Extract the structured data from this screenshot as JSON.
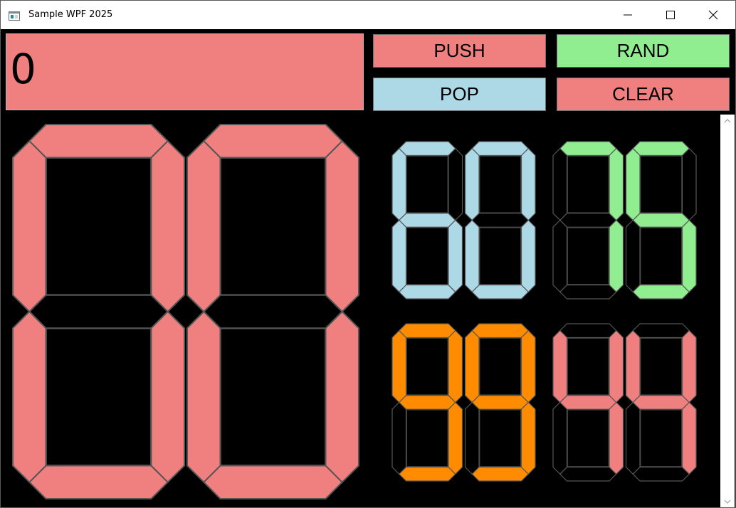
{
  "window": {
    "title": "Sample WPF 2025"
  },
  "display": {
    "value": "0"
  },
  "buttons": {
    "push": {
      "label": "PUSH",
      "color": "#f08080"
    },
    "rand": {
      "label": "RAND",
      "color": "#90ee90"
    },
    "pop": {
      "label": "POP",
      "color": "#add8e6"
    },
    "clear": {
      "label": "CLEAR",
      "color": "#f08080"
    }
  },
  "displays": {
    "main": {
      "value": "00",
      "color": "#f08080"
    },
    "blue": {
      "value": "60",
      "color": "#add8e6"
    },
    "green": {
      "value": "75",
      "color": "#90ee90"
    },
    "orange": {
      "value": "99",
      "color": "#ff8c00"
    },
    "pink": {
      "value": "44",
      "color": "#f08080"
    }
  },
  "icons": {
    "app": "app-icon",
    "minimize": "minimize-icon",
    "maximize": "maximize-icon",
    "close": "close-icon",
    "scroll_up": "scroll-up-arrow-icon",
    "scroll_down": "scroll-down-arrow-icon"
  }
}
